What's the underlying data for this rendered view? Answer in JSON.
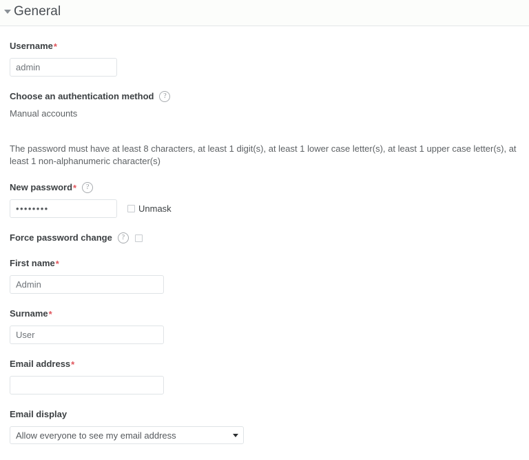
{
  "section": {
    "title": "General",
    "collapse_icon": "caret-down-icon",
    "expanded": true
  },
  "fields": {
    "username": {
      "label": "Username",
      "required_mark": "*",
      "value": "admin"
    },
    "auth_method": {
      "label": "Choose an authentication method",
      "help_icon": "help-circle-icon",
      "value": "Manual accounts"
    },
    "password_policy": {
      "text": "The password must have at least 8 characters, at least 1 digit(s), at least 1 lower case letter(s), at least 1 upper case letter(s), at least 1 non-alphanumeric character(s)"
    },
    "new_password": {
      "label": "New password",
      "required_mark": "*",
      "help_icon": "help-circle-icon",
      "value": "••••••••",
      "unmask_label": "Unmask",
      "unmask_checked": false
    },
    "force_password_change": {
      "label": "Force password change",
      "help_icon": "help-circle-icon",
      "checked": false
    },
    "first_name": {
      "label": "First name",
      "required_mark": "*",
      "value": "Admin"
    },
    "surname": {
      "label": "Surname",
      "required_mark": "*",
      "value": "User"
    },
    "email_address": {
      "label": "Email address",
      "required_mark": "*",
      "value": ""
    },
    "email_display": {
      "label": "Email display",
      "selected": "Allow everyone to see my email address",
      "arrow_icon": "chevron-down-icon"
    }
  },
  "colors": {
    "required": "#e0555c",
    "label": "#3c4043",
    "muted": "#5d6164",
    "border": "#dfe3e6",
    "header_bg": "#fcfdfb"
  }
}
